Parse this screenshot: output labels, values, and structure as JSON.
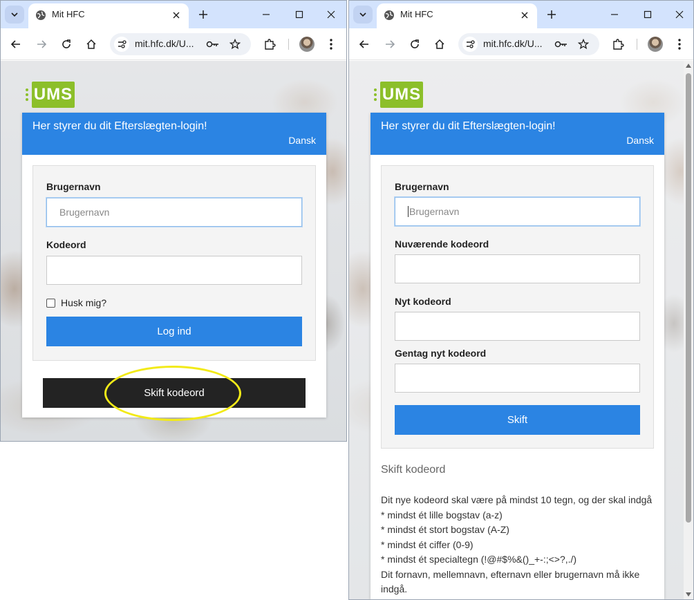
{
  "left_window": {
    "tab_title": "Mit HFC",
    "url": "mit.hfc.dk/U...",
    "logo_text": "UMS",
    "header_title": "Her styrer du dit Efterslægten-login!",
    "language": "Dansk",
    "username_label": "Brugernavn",
    "username_placeholder": "Brugernavn",
    "password_label": "Kodeord",
    "remember_label": "Husk mig?",
    "login_button": "Log ind",
    "change_password_button": "Skift kodeord"
  },
  "right_window": {
    "tab_title": "Mit HFC",
    "url": "mit.hfc.dk/U...",
    "logo_text": "UMS",
    "header_title": "Her styrer du dit Efterslægten-login!",
    "language": "Dansk",
    "username_label": "Brugernavn",
    "username_placeholder": "Brugernavn",
    "current_password_label": "Nuværende kodeord",
    "new_password_label": "Nyt kodeord",
    "repeat_password_label": "Gentag nyt kodeord",
    "submit_button": "Skift",
    "help_title": "Skift kodeord",
    "help_lines": [
      "Dit nye kodeord skal være på mindst 10 tegn, og der skal indgå",
      "* mindst ét lille bogstav (a-z)",
      "* mindst ét stort bogstav (A-Z)",
      "* mindst ét ciffer (0-9)",
      "* mindst ét specialtegn (!@#$%&()_+-:;<>?,./)",
      "Dit fornavn, mellemnavn, efternavn eller brugernavn må ikke indgå."
    ]
  },
  "colors": {
    "tab_strip": "#d3e3fd",
    "header_blue": "#2b84e3",
    "logo_green": "#8cbf2a",
    "dark_button": "#232323",
    "annotation_yellow": "#f2ea18"
  },
  "icons": [
    "tab-search-icon",
    "globe-icon",
    "close-icon",
    "plus-icon",
    "minimize-icon",
    "maximize-icon",
    "window-close-icon",
    "back-icon",
    "forward-icon",
    "reload-icon",
    "home-icon",
    "site-info-icon",
    "key-icon",
    "star-icon",
    "extensions-icon",
    "avatar",
    "more-vert-icon"
  ]
}
